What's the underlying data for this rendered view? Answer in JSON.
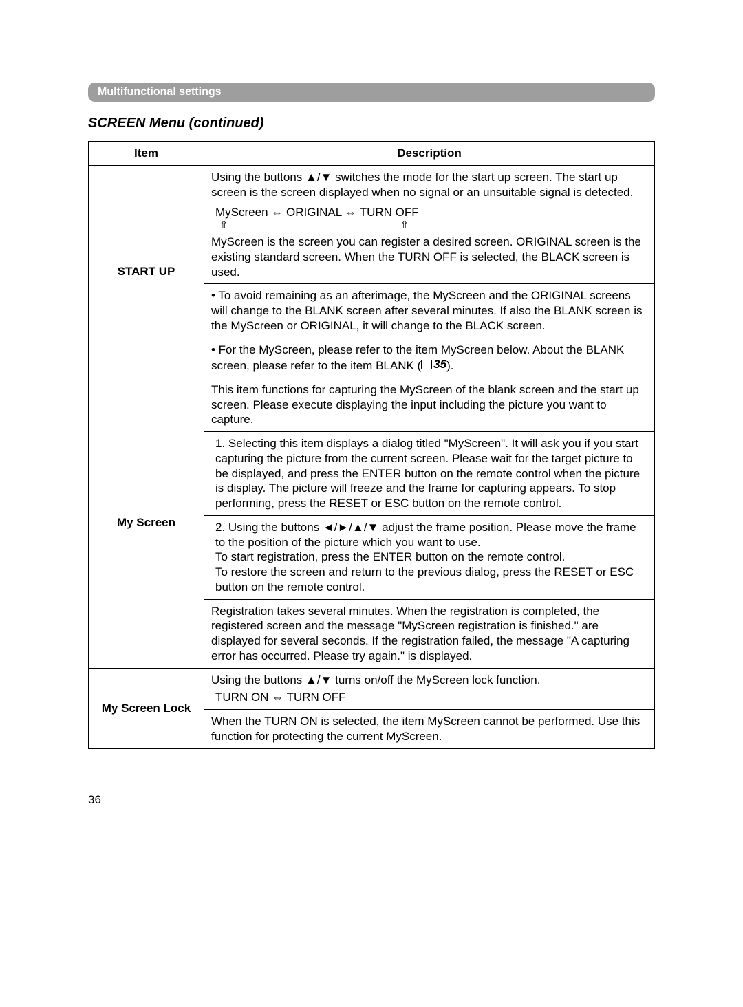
{
  "header": "Multifunctional settings",
  "section_title": "SCREEN Menu (continued)",
  "table": {
    "head_item": "Item",
    "head_desc": "Description",
    "startup": {
      "label": "START UP",
      "intro": "Using the buttons ▲/▼ switches the mode for the start up screen. The start up screen is the screen displayed when no signal or an unsuitable signal is detected.",
      "cycle": "MyScreen ⇔ ORIGINAL ⇔ TURN OFF",
      "cycle_arrows": "⇧                                                          ⇧",
      "explain": "MyScreen is the screen you can register a desired screen. ORIGINAL screen is the existing standard screen. When the TURN OFF is selected, the BLACK screen is used.",
      "bullet1": "• To avoid remaining as an afterimage, the MyScreen and the ORIGINAL screens will change to the BLANK screen after several minutes. If also the BLANK screen is the MyScreen or ORIGINAL, it will change to the BLACK screen.",
      "bullet2a": "• For the MyScreen, please refer to the item MyScreen ",
      "bullet2b_below": "below",
      "bullet2c": ". About the BLANK screen, please refer to the item BLANK (",
      "bullet2_ref": "35",
      "bullet2d": ")."
    },
    "myscreen": {
      "label": "My Screen",
      "p1": "This item functions for capturing the MyScreen of the blank screen and the start up screen. Please execute displaying the input including the picture you want to capture.",
      "p2": "1. Selecting this item displays a dialog titled \"MyScreen\". It will ask you if you start capturing the picture from the current screen. Please wait for the target picture to be displayed, and press the ENTER button on the remote control when the picture is display. The picture will freeze and the frame for capturing appears. To stop performing, press the RESET or ESC button on the remote control.",
      "p3": "2. Using the buttons ◄/►/▲/▼ adjust the frame position. Please move the frame to the position of the picture which you want to use.\nTo start registration, press the ENTER button on the remote control.\nTo restore the screen and return to the previous dialog, press the RESET or ESC button on the remote control.",
      "p4": "Registration takes several minutes. When the registration is completed, the registered screen and the message \"MyScreen registration is finished.\" are displayed for several seconds. If the registration failed, the message \"A capturing error has occurred. Please try again.\" is displayed."
    },
    "lock": {
      "label": "My Screen Lock",
      "intro": "Using the buttons ▲/▼ turns on/off the MyScreen lock function.",
      "turn": "TURN ON ⇔ TURN OFF",
      "after": "When the TURN ON is selected, the item MyScreen cannot be performed. Use this function for protecting the current MyScreen."
    }
  },
  "page_number": "36"
}
